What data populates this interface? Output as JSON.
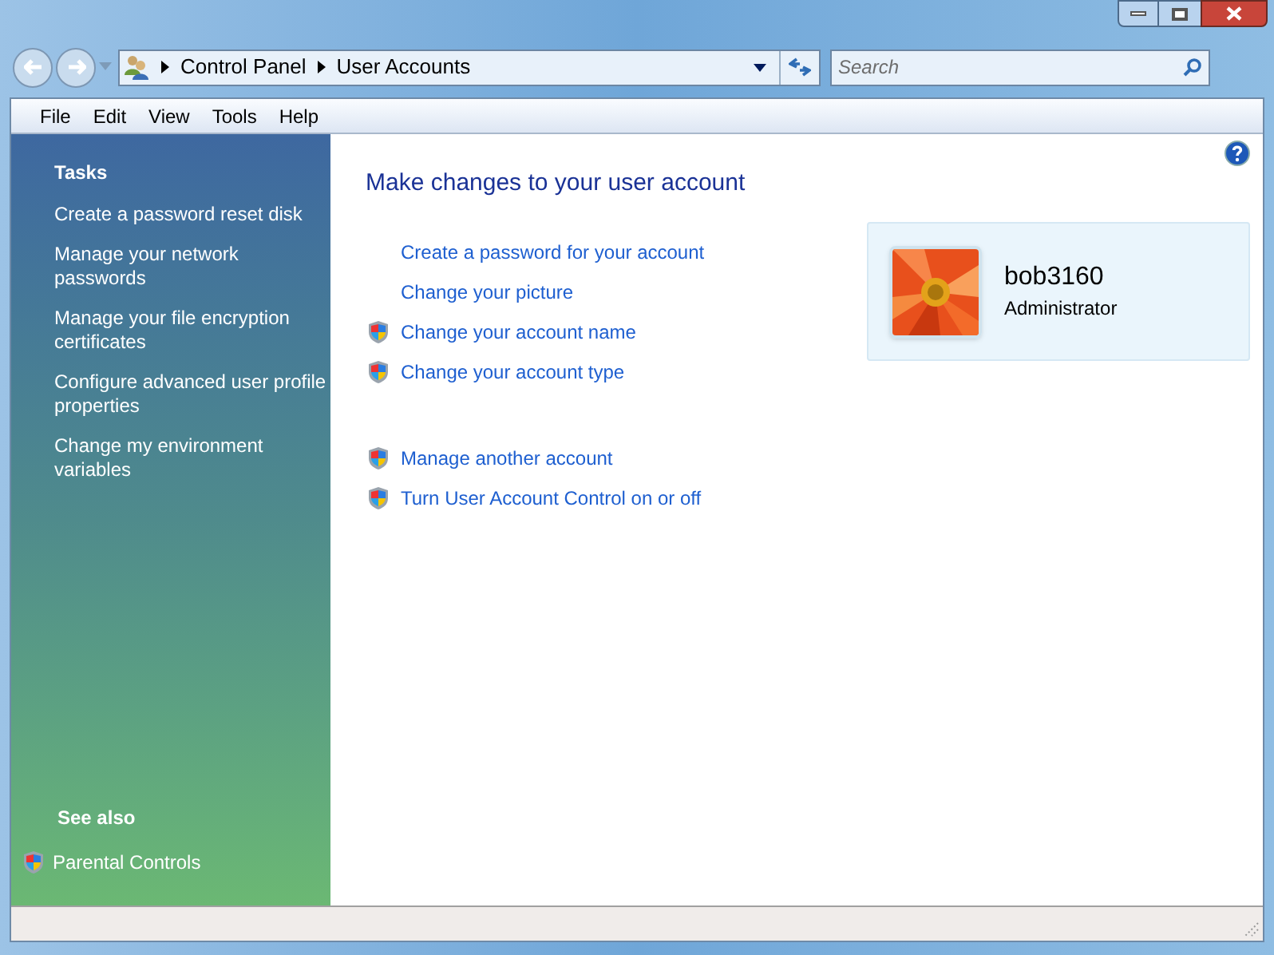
{
  "address_bar": {
    "crumbs": [
      "Control Panel",
      "User Accounts"
    ]
  },
  "search": {
    "placeholder": "Search"
  },
  "menu": [
    "File",
    "Edit",
    "View",
    "Tools",
    "Help"
  ],
  "sidebar": {
    "tasks_title": "Tasks",
    "tasks": [
      "Create a password reset disk",
      "Manage your network passwords",
      "Manage your file encryption certificates",
      "Configure advanced user profile properties",
      "Change my environment variables"
    ],
    "see_also_title": "See also",
    "see_also": [
      {
        "label": "Parental Controls",
        "shield": true
      }
    ]
  },
  "main": {
    "title": "Make changes to your user account",
    "link_groups": [
      [
        {
          "label": "Create a password for your account",
          "shield": false
        },
        {
          "label": "Change your picture",
          "shield": false
        },
        {
          "label": "Change your account name",
          "shield": true
        },
        {
          "label": "Change your account type",
          "shield": true
        }
      ],
      [
        {
          "label": "Manage another account",
          "shield": true
        },
        {
          "label": "Turn User Account Control on or off",
          "shield": true
        }
      ]
    ]
  },
  "account": {
    "name": "bob3160",
    "type": "Administrator"
  }
}
